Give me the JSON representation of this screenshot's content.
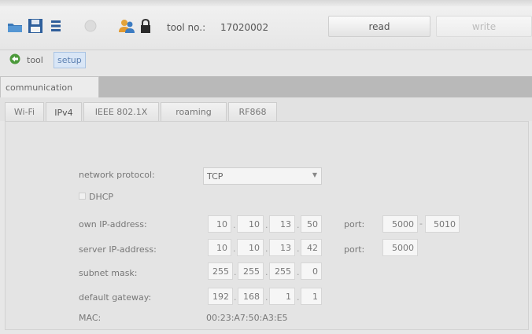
{
  "toolbar": {
    "icons": [
      "open-icon",
      "save-icon",
      "list-icon",
      "disabled-icon",
      "users-icon",
      "lock-icon"
    ],
    "tool_no_label": "tool no.:",
    "tool_no_value": "17020002",
    "read_label": "read",
    "write_label": "write"
  },
  "breadcrumb": {
    "tool": "tool",
    "setup": "setup"
  },
  "panel": {
    "tab_label": "communication"
  },
  "subtabs": [
    "Wi-Fi",
    "IPv4",
    "IEEE 802.1X",
    "roaming",
    "RF868"
  ],
  "active_subtab": "IPv4",
  "form": {
    "network_protocol_label": "network protocol:",
    "network_protocol_value": "TCP",
    "dhcp_label": "DHCP",
    "dhcp_checked": false,
    "own_ip_label": "own IP-address:",
    "own_ip": [
      "10",
      "10",
      "13",
      "50"
    ],
    "own_port_label": "port:",
    "own_port_1": "5000",
    "own_port_2": "5010",
    "server_ip_label": "server IP-address:",
    "server_ip": [
      "10",
      "10",
      "13",
      "42"
    ],
    "server_port_label": "port:",
    "server_port": "5000",
    "subnet_label": "subnet mask:",
    "subnet": [
      "255",
      "255",
      "255",
      "0"
    ],
    "gateway_label": "default gateway:",
    "gateway": [
      "192",
      "168",
      "1",
      "1"
    ],
    "mac_label": "MAC:",
    "mac_value": "00:23:A7:50:A3:E5"
  }
}
